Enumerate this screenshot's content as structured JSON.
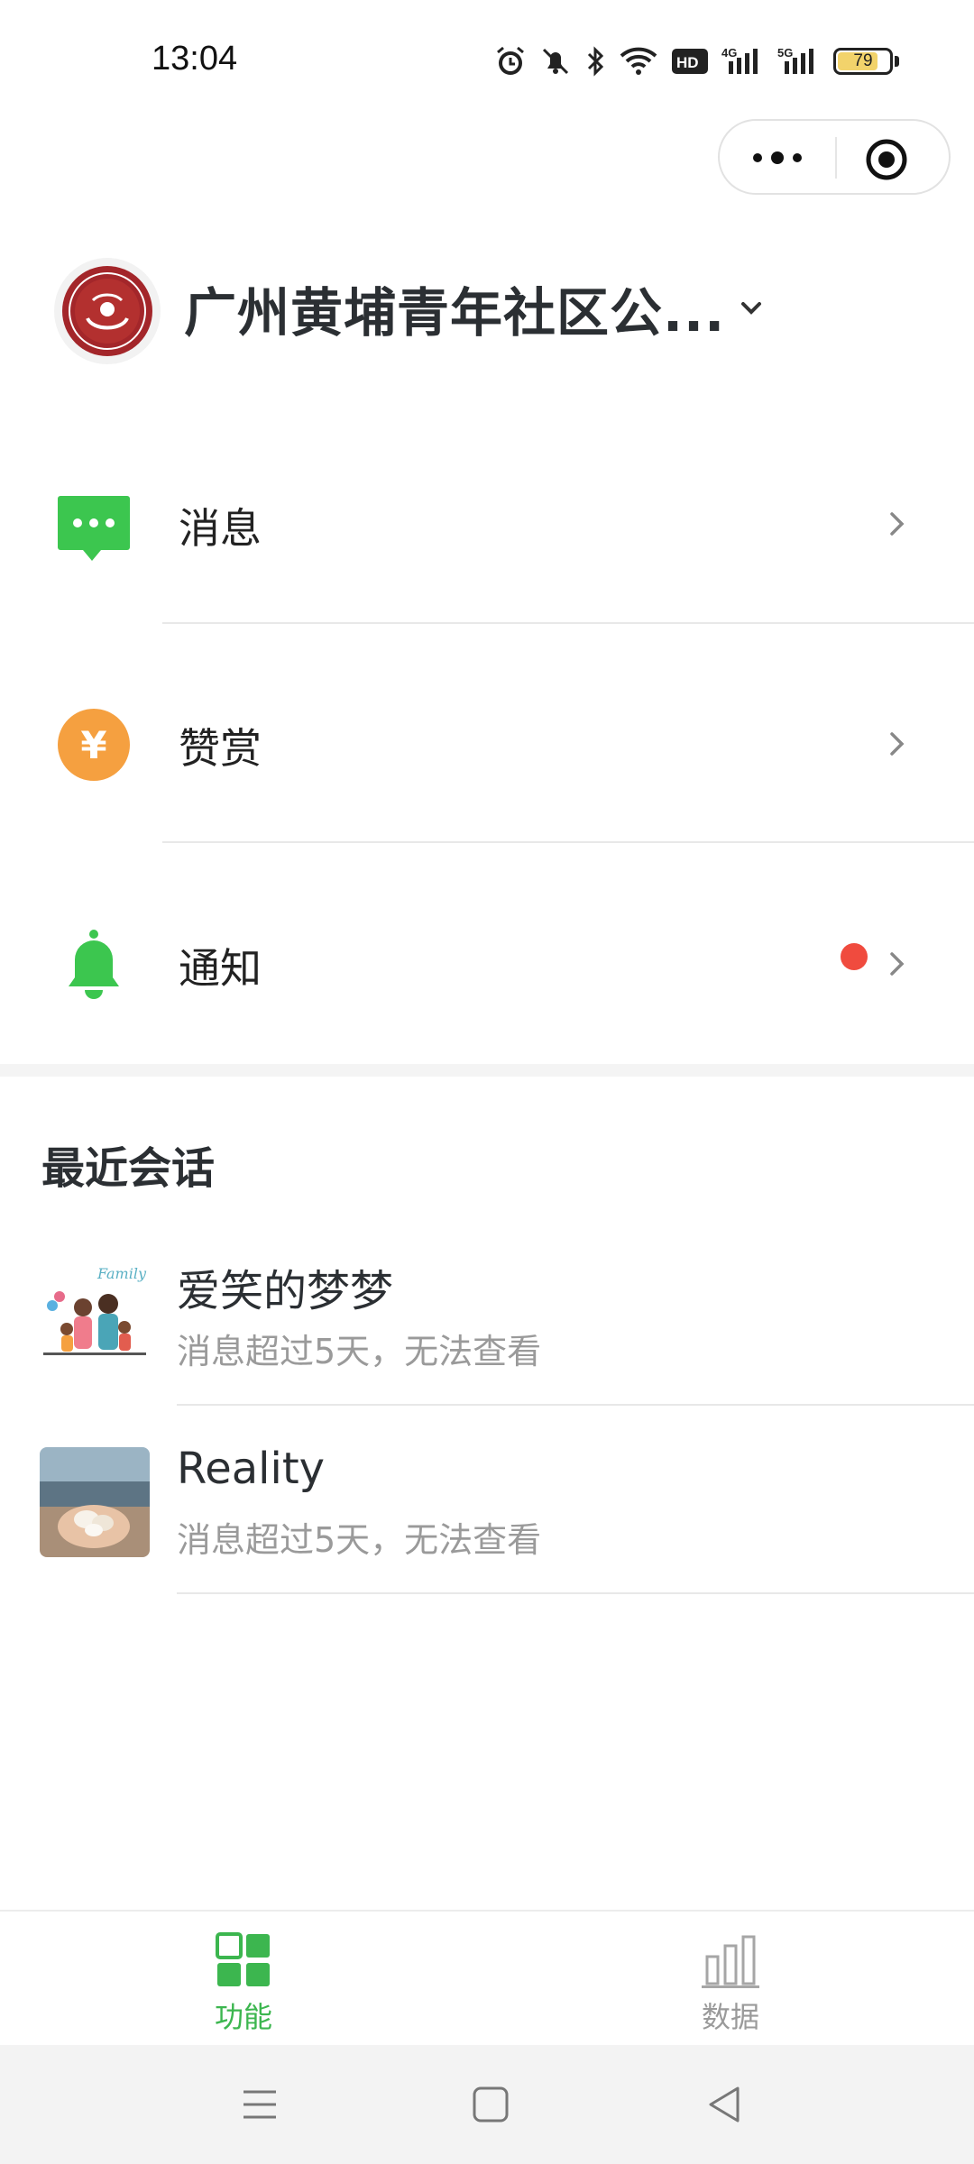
{
  "status_bar": {
    "time": "13:04",
    "icons": [
      "alarm-icon",
      "mute-icon",
      "bluetooth-icon",
      "wifi-icon",
      "hd-icon",
      "4g-signal-icon",
      "5g-signal-icon"
    ],
    "battery": "79",
    "battery_level": 0.79
  },
  "capsule": {
    "more_icon": "more-dots-icon",
    "close_icon": "target-close-icon"
  },
  "account": {
    "name": "广州黄埔青年社区公...",
    "avatar": "community-emblem"
  },
  "menu": [
    {
      "label": "消息",
      "icon": "chat-bubble-icon",
      "color": "#3cc64f",
      "has_dot": false
    },
    {
      "label": "赞赏",
      "icon": "yuan-coin-icon",
      "color": "#f5a040",
      "has_dot": false
    },
    {
      "label": "通知",
      "icon": "bell-icon",
      "color": "#3cc64f",
      "has_dot": true,
      "dot_color": "#f04b3e"
    }
  ],
  "recent": {
    "title": "最近会话",
    "items": [
      {
        "name": "爱笑的梦梦",
        "subtitle": "消息超过5天，无法查看"
      },
      {
        "name": "Reality",
        "subtitle": "消息超过5天，无法查看"
      }
    ]
  },
  "tabbar": {
    "tabs": [
      {
        "label": "功能",
        "active": true,
        "icon": "grid-icon",
        "color": "#3cb64f"
      },
      {
        "label": "数据",
        "active": false,
        "icon": "bar-chart-icon",
        "color": "#9a9a9a"
      }
    ]
  },
  "system_nav": [
    "menu-icon",
    "home-icon",
    "back-icon"
  ]
}
